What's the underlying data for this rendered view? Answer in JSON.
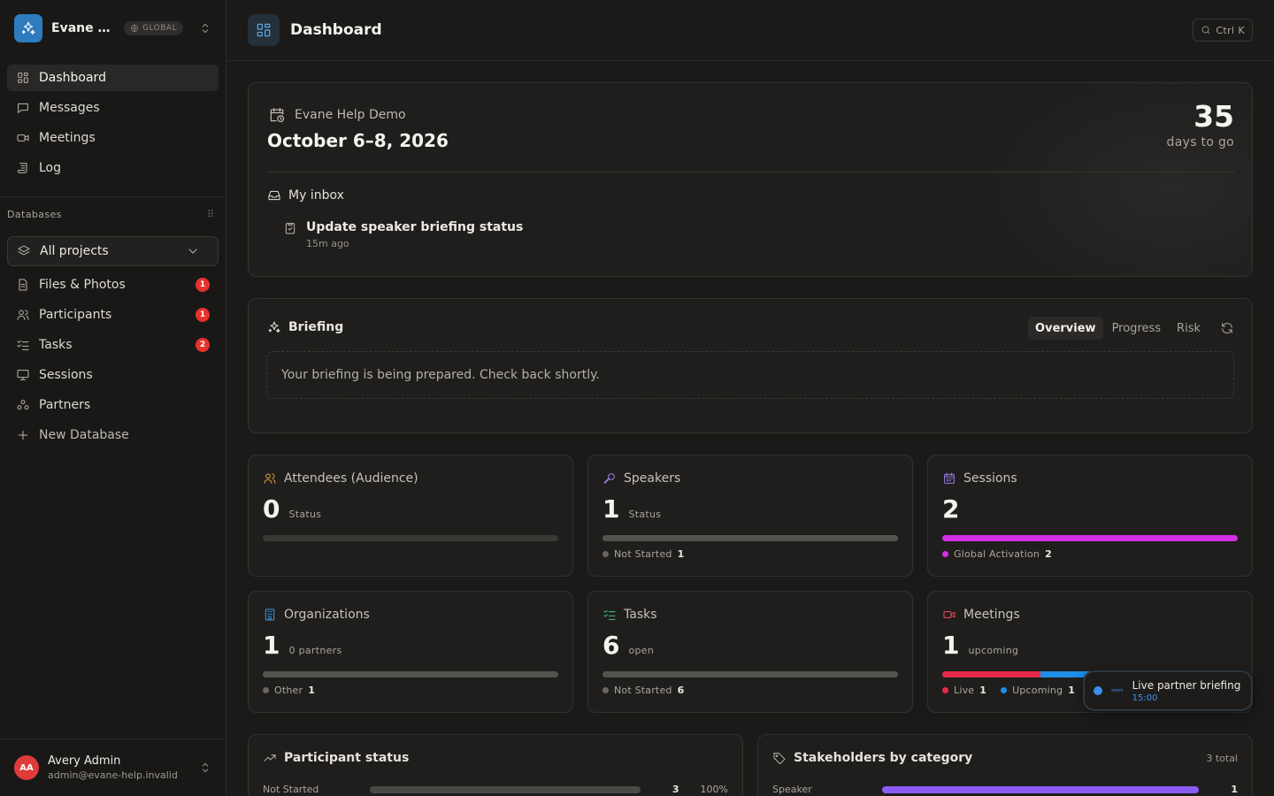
{
  "workspace": {
    "name": "Evane Help Demo",
    "scope_badge": "GLOBAL"
  },
  "nav": [
    {
      "label": "Dashboard",
      "icon": "dashboard-icon",
      "active": true
    },
    {
      "label": "Messages",
      "icon": "message-icon"
    },
    {
      "label": "Meetings",
      "icon": "video-icon"
    },
    {
      "label": "Log",
      "icon": "log-icon"
    }
  ],
  "databases": {
    "heading": "Databases",
    "project_select": "All projects",
    "items": [
      {
        "label": "Files & Photos",
        "icon": "file-icon",
        "badge": "1"
      },
      {
        "label": "Participants",
        "icon": "users-icon",
        "badge": "1"
      },
      {
        "label": "Tasks",
        "icon": "checklist-icon",
        "badge": "2"
      },
      {
        "label": "Sessions",
        "icon": "presentation-icon"
      },
      {
        "label": "Partners",
        "icon": "partners-icon"
      }
    ],
    "new_label": "New Database"
  },
  "user": {
    "initials": "AA",
    "name": "Avery Admin",
    "email": "admin@evane-help.invalid"
  },
  "header": {
    "title": "Dashboard",
    "search_shortcut": "Ctrl K"
  },
  "event": {
    "name": "Evane Help Demo",
    "dates": "October 6–8, 2026",
    "countdown_value": "35",
    "countdown_label": "days to go",
    "inbox_heading": "My inbox",
    "inbox_item_title": "Update speaker briefing status",
    "inbox_item_time": "15m ago"
  },
  "briefing": {
    "title": "Briefing",
    "tabs": [
      "Overview",
      "Progress",
      "Risk"
    ],
    "active_tab": "Overview",
    "message": "Your briefing is being prepared. Check back shortly."
  },
  "stats": [
    {
      "title": "Attendees (Audience)",
      "icon": "users-icon",
      "icon_color": "#e8a33b",
      "value": "0",
      "sub": "Status",
      "segments": [],
      "legend": []
    },
    {
      "title": "Speakers",
      "icon": "mic-icon",
      "icon_color": "#9b7ee8",
      "value": "1",
      "sub": "Status",
      "segments": [
        {
          "fraction": 1.0,
          "color": "#55534f"
        }
      ],
      "legend": [
        {
          "label": "Not Started",
          "count": "1",
          "color": "#6a6763"
        }
      ]
    },
    {
      "title": "Sessions",
      "icon": "calendar-icon",
      "icon_color": "#9b7ee8",
      "value": "2",
      "sub": "",
      "segments": [
        {
          "fraction": 1.0,
          "color": "#d52ee6"
        }
      ],
      "legend": [
        {
          "label": "Global Activation",
          "count": "2",
          "color": "#d52ee6"
        }
      ]
    },
    {
      "title": "Organizations",
      "icon": "building-icon",
      "icon_color": "#3b9ae8",
      "value": "1",
      "sub": "0 partners",
      "segments": [
        {
          "fraction": 1.0,
          "color": "#55534f"
        }
      ],
      "legend": [
        {
          "label": "Other",
          "count": "1",
          "color": "#6a6763"
        }
      ]
    },
    {
      "title": "Tasks",
      "icon": "checklist-icon",
      "icon_color": "#3fc28a",
      "value": "6",
      "sub": "open",
      "segments": [
        {
          "fraction": 1.0,
          "color": "#55534f"
        }
      ],
      "legend": [
        {
          "label": "Not Started",
          "count": "6",
          "color": "#6a6763"
        }
      ]
    },
    {
      "title": "Meetings",
      "icon": "video-icon",
      "icon_color": "#e85060",
      "value": "1",
      "sub": "upcoming",
      "segments": [
        {
          "fraction": 0.333,
          "color": "#e82a4a"
        },
        {
          "fraction": 0.333,
          "color": "#1e8ee6"
        },
        {
          "fraction": 0.334,
          "color": "#55534f"
        }
      ],
      "legend": [
        {
          "label": "Live",
          "count": "1",
          "color": "#e82a4a"
        },
        {
          "label": "Upcoming",
          "count": "1",
          "color": "#1e8ee6"
        },
        {
          "label": "",
          "count": "",
          "color": "#6a6763"
        }
      ]
    }
  ],
  "toast": {
    "logo_text": "zoom",
    "title": "Live partner briefing",
    "time": "15:00"
  },
  "participant_status": {
    "title": "Participant status",
    "row": {
      "label": "Not Started",
      "count": "3",
      "percent": "100%",
      "fraction": 1.0
    }
  },
  "stakeholders": {
    "title": "Stakeholders by category",
    "total": "3 total",
    "row": {
      "label": "Speaker",
      "count": "1",
      "fraction": 1.0,
      "color": "#8b5cf6"
    }
  }
}
